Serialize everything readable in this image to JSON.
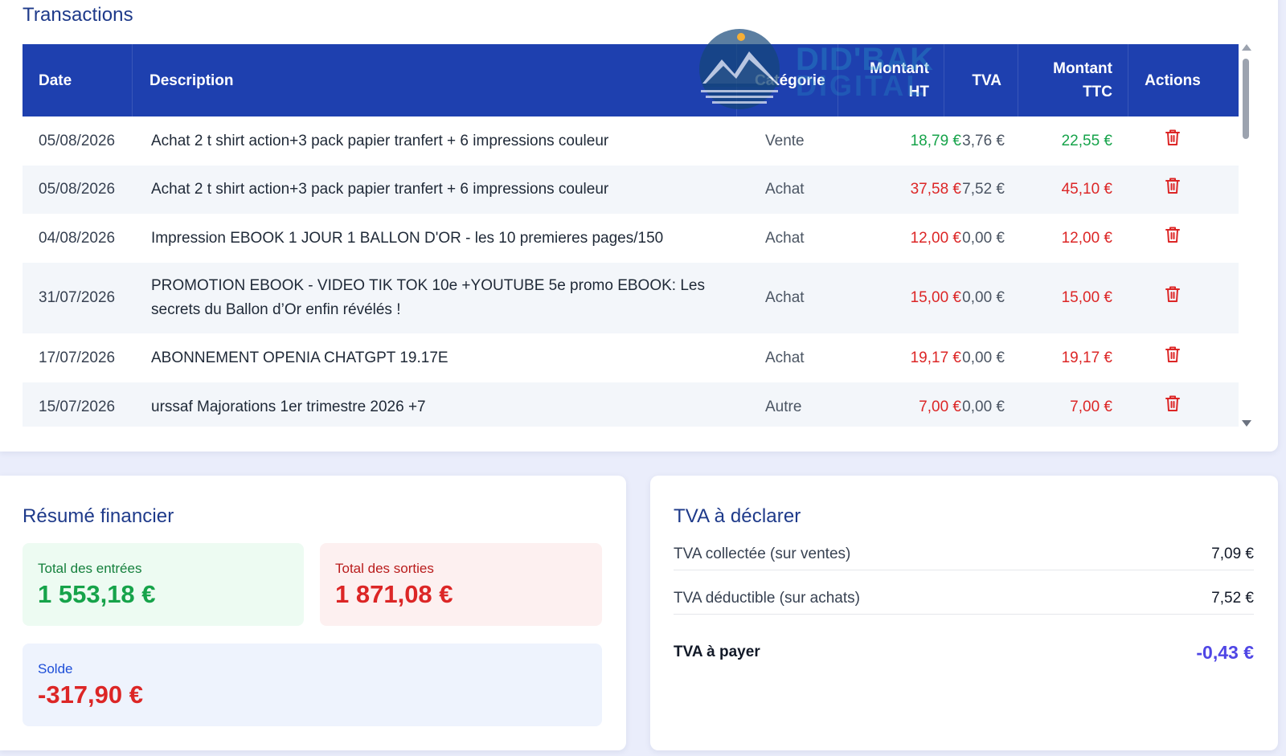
{
  "transactions": {
    "title": "Transactions",
    "columns": {
      "date": "Date",
      "description": "Description",
      "category": "Catégorie",
      "montant_ht_line1": "Montant",
      "montant_ht_line2": "HT",
      "tva": "TVA",
      "montant_ttc_line1": "Montant",
      "montant_ttc_line2": "TTC",
      "actions": "Actions"
    },
    "rows": [
      {
        "date": "05/08/2026",
        "description": "Achat 2 t shirt action+3 pack papier tranfert + 6 impressions couleur",
        "category": "Vente",
        "ht": "18,79 €",
        "tva": "3,76 €",
        "ttc": "22,55 €",
        "sign": "pos"
      },
      {
        "date": "05/08/2026",
        "description": "Achat 2 t shirt action+3 pack papier tranfert + 6 impressions couleur",
        "category": "Achat",
        "ht": "37,58 €",
        "tva": "7,52 €",
        "ttc": "45,10 €",
        "sign": "neg"
      },
      {
        "date": "04/08/2026",
        "description": "Impression EBOOK 1 JOUR 1 BALLON D'OR - les 10 premieres pages/150",
        "category": "Achat",
        "ht": "12,00 €",
        "tva": "0,00 €",
        "ttc": "12,00 €",
        "sign": "neg"
      },
      {
        "date": "31/07/2026",
        "description_line1": "PROMOTION EBOOK - VIDEO TIK TOK 10e +YOUTUBE 5e promo EBOOK: Les",
        "description_line2": "secrets du Ballon d’Or enfin révélés !",
        "category": "Achat",
        "ht": "15,00 €",
        "tva": "0,00 €",
        "ttc": "15,00 €",
        "sign": "neg"
      },
      {
        "date": "17/07/2026",
        "description": "ABONNEMENT OPENIA CHATGPT 19.17E",
        "category": "Achat",
        "ht": "19,17 €",
        "tva": "0,00 €",
        "ttc": "19,17 €",
        "sign": "neg"
      },
      {
        "date": "15/07/2026",
        "description": "urssaf Majorations 1er trimestre 2026 +7",
        "category": "Autre",
        "ht": "7,00 €",
        "tva": "0,00 €",
        "ttc": "7,00 €",
        "sign": "neg"
      }
    ],
    "delete_icon": "trash-icon"
  },
  "watermark": {
    "line1": "DID'BAK",
    "line2": "DIGITAL"
  },
  "summary": {
    "title": "Résumé financier",
    "total_in_label": "Total des entrées",
    "total_in_value": "1 553,18 €",
    "total_out_label": "Total des sorties",
    "total_out_value": "1 871,08 €",
    "solde_label": "Solde",
    "solde_value": "-317,90 €"
  },
  "tva": {
    "title": "TVA à déclarer",
    "collected_label": "TVA collectée (sur ventes)",
    "collected_value": "7,09 €",
    "deductible_label": "TVA déductible (sur achats)",
    "deductible_value": "7,52 €",
    "to_pay_label": "TVA à payer",
    "to_pay_value": "-0,43 €"
  },
  "colors": {
    "header_bg": "#1e40af",
    "positive": "#16a34a",
    "negative": "#dc2626",
    "accent_title": "#1e3a8a",
    "tva_to_pay": "#4f46e5"
  }
}
